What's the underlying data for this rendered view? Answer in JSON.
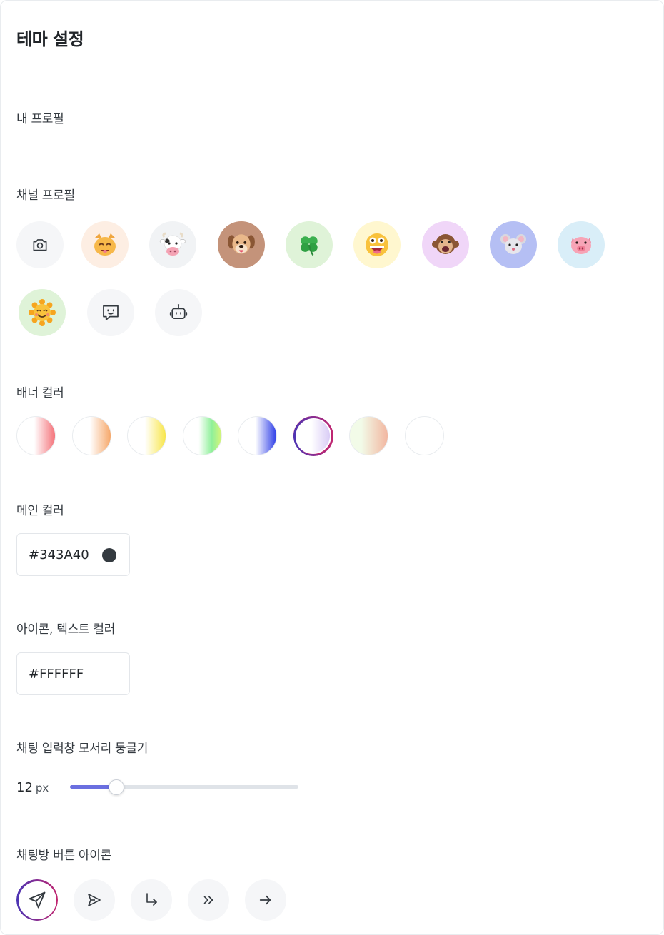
{
  "page_title": "테마 설정",
  "sections": {
    "my_profile": "내 프로필",
    "channel_profile": "채널 프로필",
    "banner_color": "배너 컬러",
    "main_color": "메인 컬러",
    "icon_text_color": "아이콘, 텍스트 컬러",
    "input_radius": "채팅 입력창 모서리 둥글기",
    "chat_button_icon": "채팅방 버튼 아이콘"
  },
  "profile_options": [
    {
      "name": "camera-icon",
      "bg": "#f5f6f8"
    },
    {
      "name": "cat-emoji",
      "bg": "#fdeee3"
    },
    {
      "name": "cow-emoji",
      "bg": "#f1f3f5"
    },
    {
      "name": "dog-emoji",
      "bg": "#c4937a"
    },
    {
      "name": "clover-emoji",
      "bg": "#dff3d8"
    },
    {
      "name": "grinning-face-emoji",
      "bg": "#fff7cf"
    },
    {
      "name": "monkey-emoji",
      "bg": "#f0d6f8"
    },
    {
      "name": "mouse-emoji",
      "bg": "#b5bff4"
    },
    {
      "name": "pig-emoji",
      "bg": "#d9eef8"
    },
    {
      "name": "sun-face-emoji",
      "bg": "#dff3d8"
    },
    {
      "name": "chat-bubble-icon",
      "bg": "#f5f6f8"
    },
    {
      "name": "robot-icon",
      "bg": "#f5f6f8"
    }
  ],
  "banner_colors": [
    {
      "name": "red",
      "accent": "#f4737a"
    },
    {
      "name": "orange",
      "accent": "#f6a86a"
    },
    {
      "name": "yellow",
      "accent": "#f8e64a"
    },
    {
      "name": "green",
      "accent": "#8ff09a"
    },
    {
      "name": "blue",
      "accent": "#2f3fe8"
    },
    {
      "name": "lavender",
      "accent": "#d6c8f5",
      "selected": true
    },
    {
      "name": "peach-green",
      "accent": "#f2b6a0"
    },
    {
      "name": "white",
      "accent": "#ffffff"
    }
  ],
  "main_color": {
    "value": "#343A40",
    "dot": "#343a40"
  },
  "icon_text_color": {
    "value": "#FFFFFF"
  },
  "radius": {
    "value": "12",
    "unit": "px",
    "fill_fraction": 0.2
  },
  "chat_button_icons": [
    {
      "name": "paper-plane-icon",
      "selected": true
    },
    {
      "name": "send-triangle-icon",
      "selected": false
    },
    {
      "name": "return-arrow-icon",
      "selected": false
    },
    {
      "name": "double-chevron-icon",
      "selected": false
    },
    {
      "name": "arrow-right-icon",
      "selected": false
    }
  ],
  "colors": {
    "selected_ring_start": "#4b35b5",
    "selected_ring_end": "#c2256f",
    "slider_fill": "#6b6fe0"
  }
}
